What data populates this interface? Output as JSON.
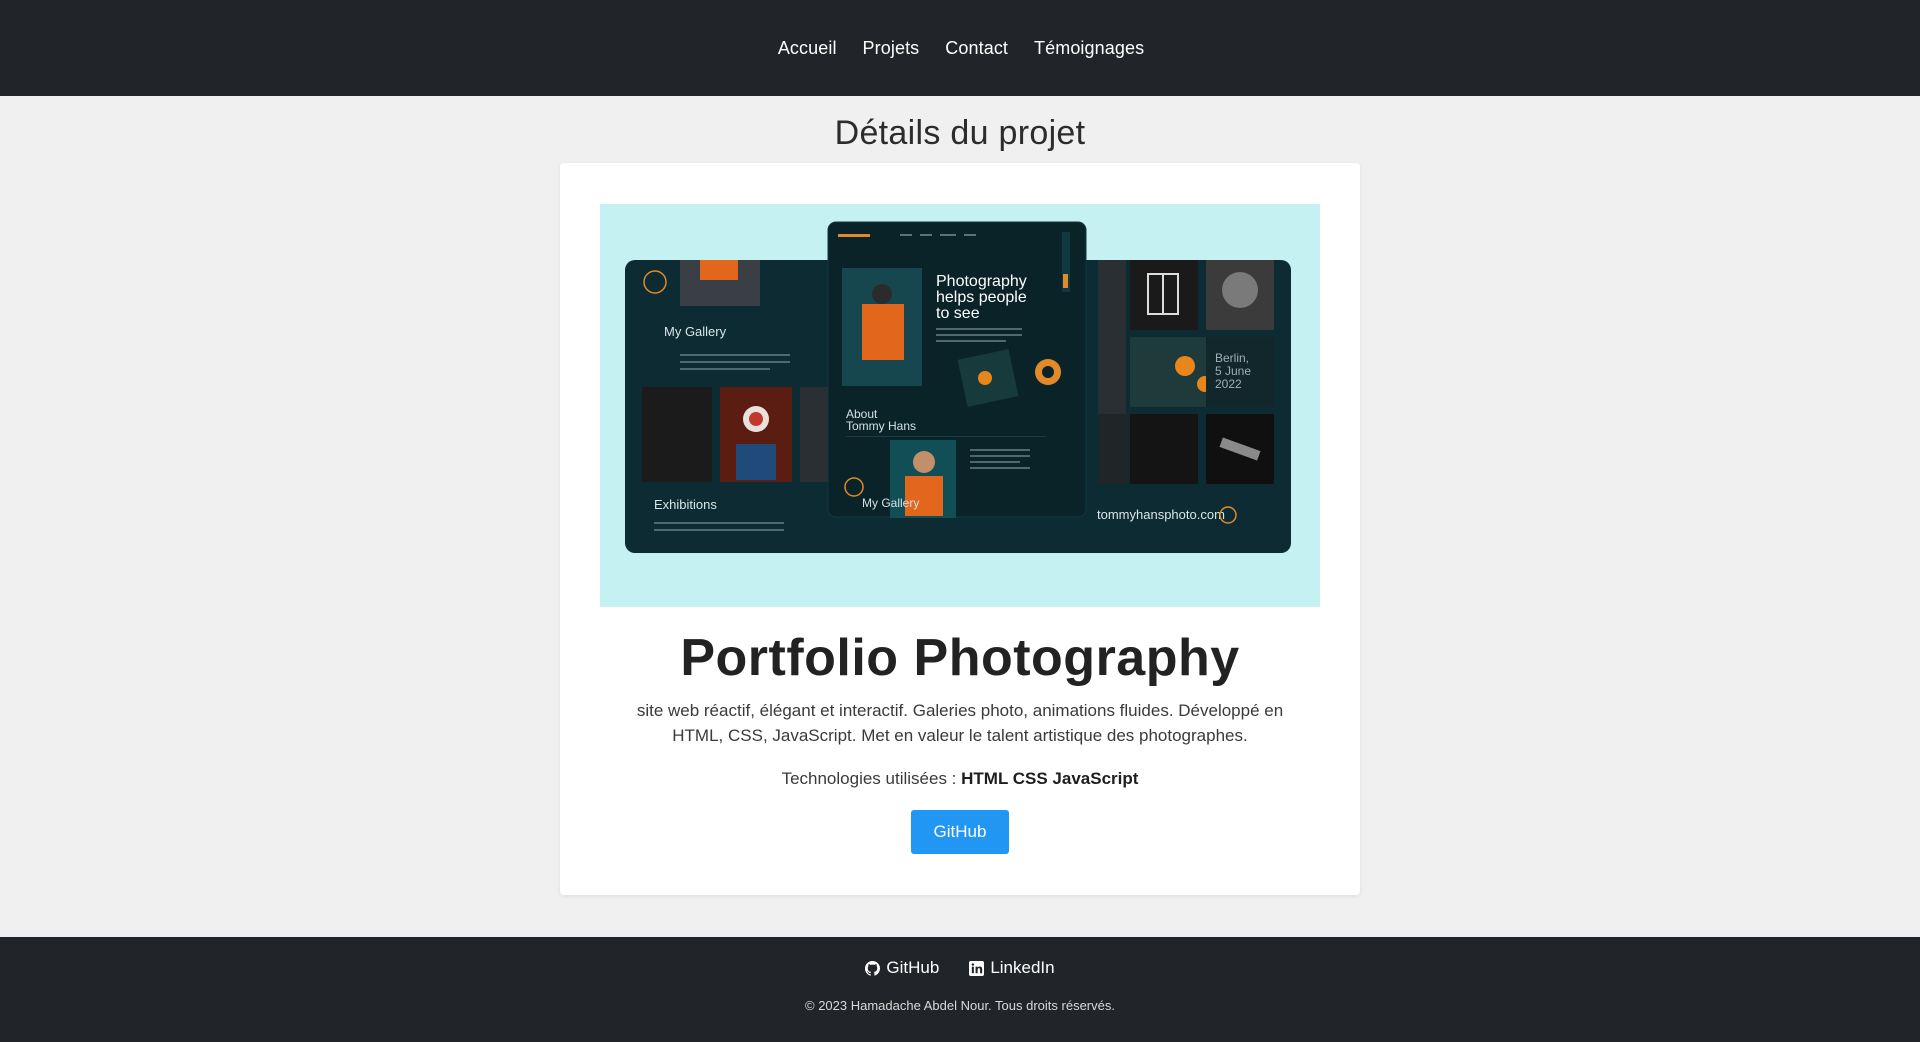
{
  "nav": {
    "items": [
      {
        "label": "Accueil"
      },
      {
        "label": "Projets"
      },
      {
        "label": "Contact"
      },
      {
        "label": "Témoignages"
      }
    ]
  },
  "main": {
    "page_title": "Détails du projet",
    "project": {
      "title": "Portfolio Photography",
      "description": "site web réactif, élégant et interactif. Galeries photo, animations fluides. Développé en HTML, CSS, JavaScript. Met en valeur le talent artistique des photographes.",
      "tech_prefix": "Technologies utilisées :",
      "tech_list": "HTML CSS JavaScript",
      "github_label": "GitHub"
    },
    "preview": {
      "hero_line1": "Photography",
      "hero_line2": "helps people",
      "hero_line3": "to see",
      "about_line1": "About",
      "about_line2": "Tommy Hans",
      "gallery_label": "My Gallery",
      "gallery_label_left": "My Gallery",
      "exhibitions_label": "Exhibitions",
      "berlin_line1": "Berlin,",
      "berlin_line2": "5 June",
      "berlin_line3": "2022",
      "site_url": "tommyhansphoto.com"
    }
  },
  "footer": {
    "links": [
      {
        "label": "GitHub",
        "icon": "github-icon"
      },
      {
        "label": "LinkedIn",
        "icon": "linkedin-icon"
      }
    ],
    "copyright": "© 2023 Hamadache Abdel Nour. Tous droits réservés."
  },
  "colors": {
    "header_bg": "#212529",
    "accent": "#2196f3",
    "preview_bg": "#c6f1f2",
    "mock_dark": "#0c2b33",
    "mock_orange": "#f07a1a"
  }
}
